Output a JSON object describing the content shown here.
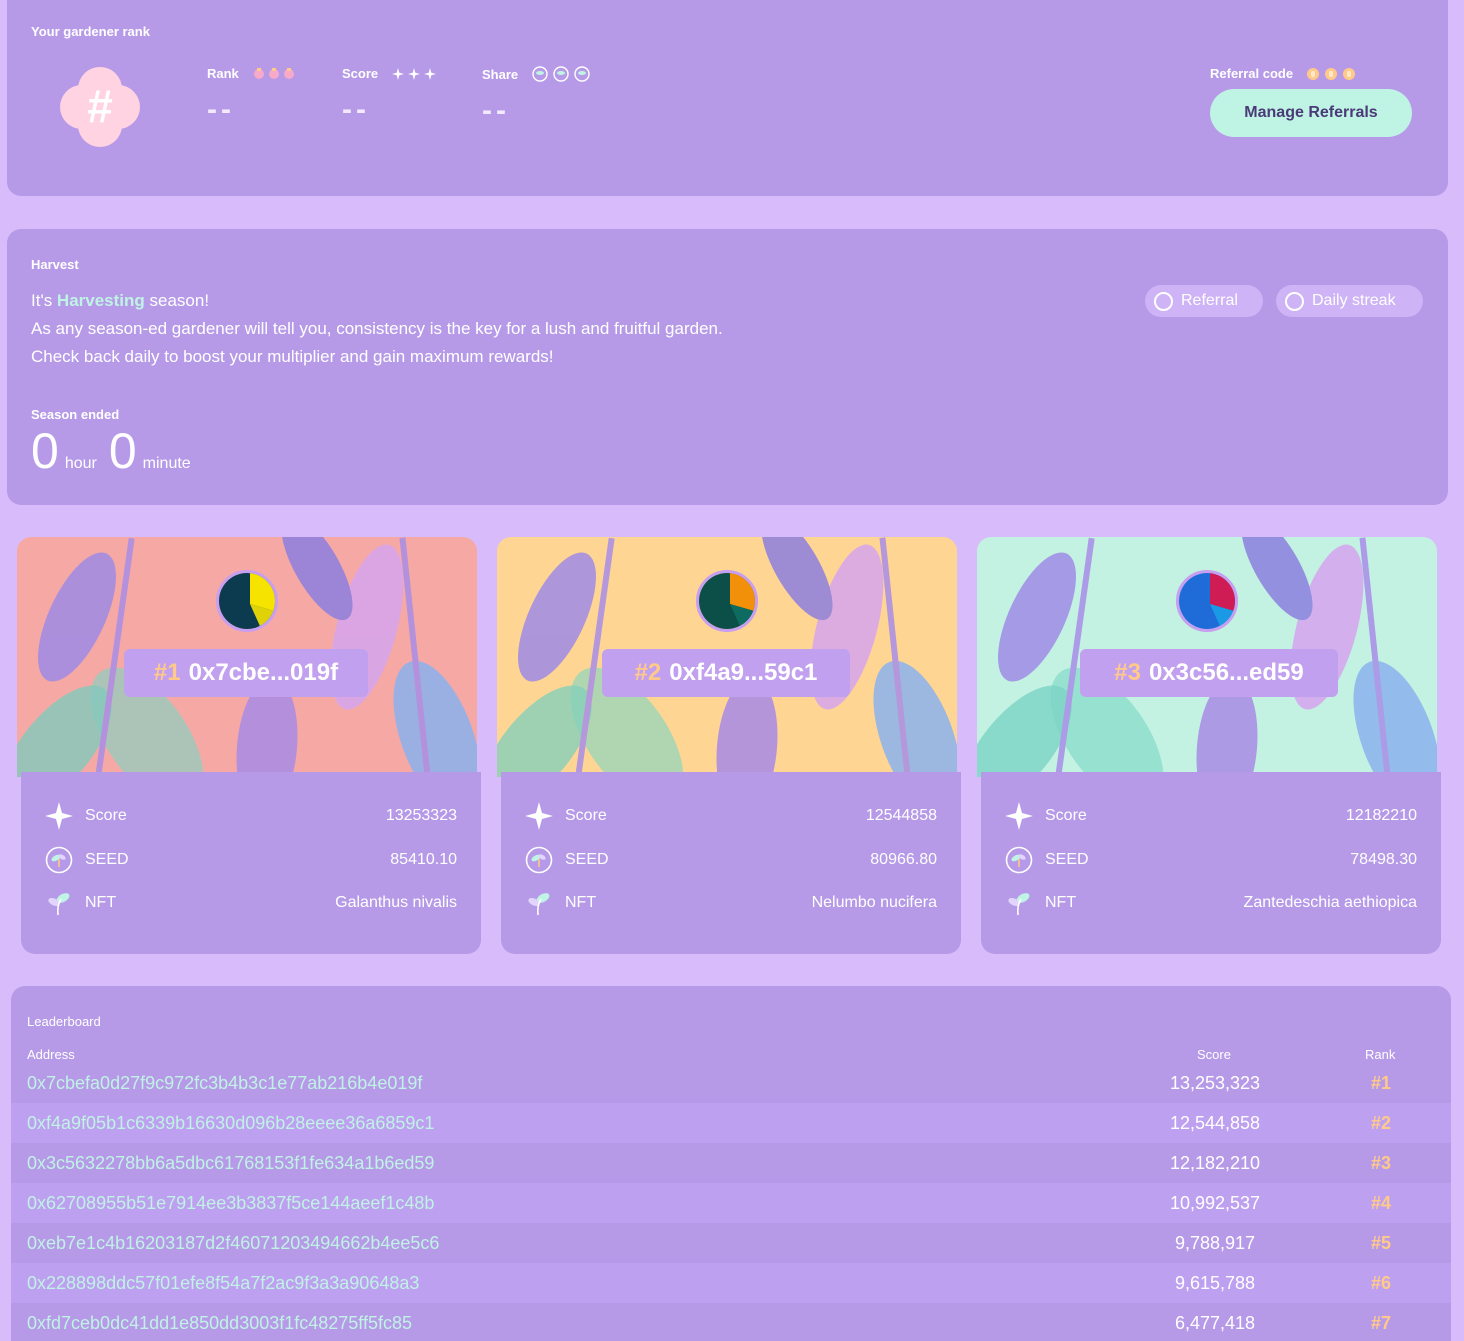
{
  "rank_panel": {
    "title": "Your gardener rank",
    "badge_symbol": "#",
    "rank_label": "Rank",
    "rank_value": "--",
    "score_label": "Score",
    "score_value": "--",
    "share_label": "Share",
    "share_value": "--",
    "referral_label": "Referral code",
    "manage_button": "Manage Referrals"
  },
  "harvest": {
    "title": "Harvest",
    "line1_prefix": "It's ",
    "line1_highlight": "Harvesting",
    "line1_suffix": " season!",
    "body": "As any season-ed gardener will tell you, consistency is the key for a lush and fruitful garden. Check back daily to boost your multiplier and gain maximum rewards!",
    "referral_toggle": "Referral",
    "streak_toggle": "Daily streak",
    "season_label": "Season ended",
    "hours": "0",
    "hours_unit": "hour",
    "minutes": "0",
    "minutes_unit": "minute"
  },
  "cards": [
    {
      "rank": "#1",
      "address": "0x7cbe...019f",
      "score_label": "Score",
      "score": "13253323",
      "seed_label": "SEED",
      "seed": "85410.10",
      "nft_label": "NFT",
      "nft": "Galanthus nivalis",
      "bg": "#f6a9a4"
    },
    {
      "rank": "#2",
      "address": "0xf4a9...59c1",
      "score_label": "Score",
      "score": "12544858",
      "seed_label": "SEED",
      "seed": "80966.80",
      "nft_label": "NFT",
      "nft": "Nelumbo nucifera",
      "bg": "#ffd594"
    },
    {
      "rank": "#3",
      "address": "0x3c56...ed59",
      "score_label": "Score",
      "score": "12182210",
      "seed_label": "SEED",
      "seed": "78498.30",
      "nft_label": "NFT",
      "nft": "Zantedeschia aethiopica",
      "bg": "#c3f1e2"
    }
  ],
  "leaderboard": {
    "title": "Leaderboard",
    "col_address": "Address",
    "col_score": "Score",
    "col_rank": "Rank",
    "rows": [
      {
        "address": "0x7cbefa0d27f9c972fc3b4b3c1e77ab216b4e019f",
        "score": "13,253,323",
        "rank": "#1"
      },
      {
        "address": "0xf4a9f05b1c6339b16630d096b28eeee36a6859c1",
        "score": "12,544,858",
        "rank": "#2"
      },
      {
        "address": "0x3c5632278bb6a5dbc61768153f1fe634a1b6ed59",
        "score": "12,182,210",
        "rank": "#3"
      },
      {
        "address": "0x62708955b51e7914ee3b3837f5ce144aeef1c48b",
        "score": "10,992,537",
        "rank": "#4"
      },
      {
        "address": "0xeb7e1c4b16203187d2f46071203494662b4ee5c6",
        "score": "9,788,917",
        "rank": "#5"
      },
      {
        "address": "0x228898ddc57f01efe8f54a7f2ac9f3a3a90648a3",
        "score": "9,615,788",
        "rank": "#6"
      },
      {
        "address": "0xfd7ceb0dc41dd1e850dd3003f1fc48275ff5fc85",
        "score": "6,477,418",
        "rank": "#7"
      }
    ]
  },
  "colors": {
    "background": "#d8bbfb",
    "panel": "#b69ae8",
    "accent_mint": "#bff3e4",
    "accent_orange": "#ffc98a"
  },
  "icons": {
    "rank": "peach-icon",
    "score": "sparkle-icon",
    "share": "seed-coin-icon",
    "referral": "coin-icon",
    "nft": "sprout-icon"
  }
}
